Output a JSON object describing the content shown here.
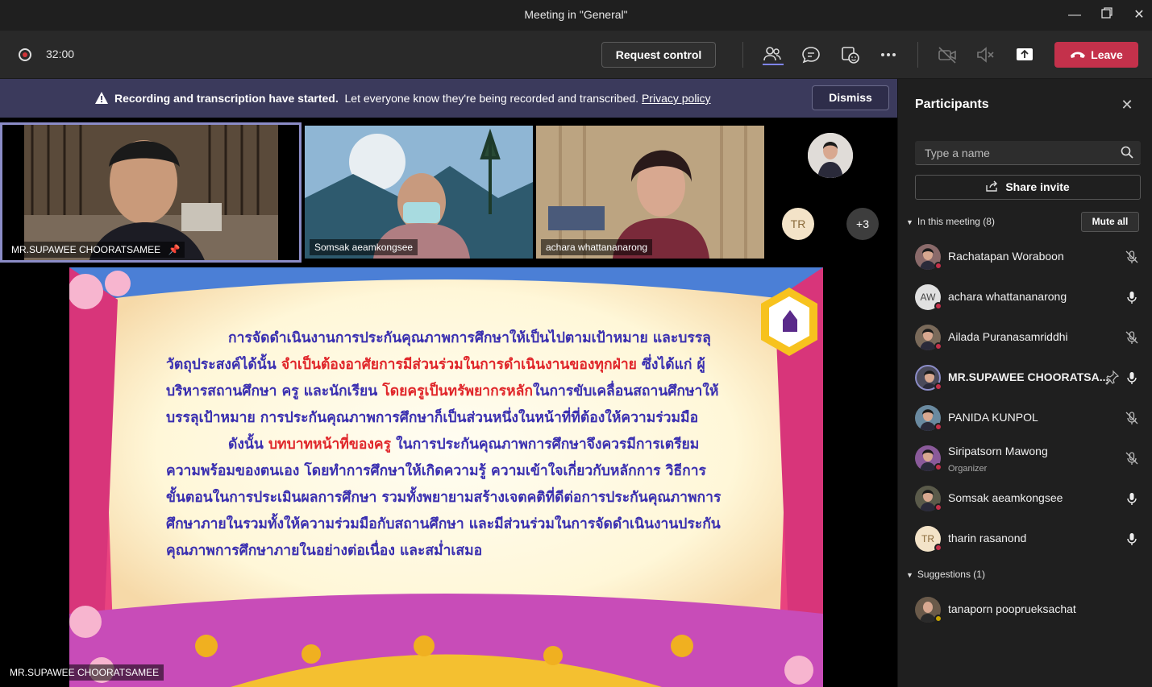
{
  "window": {
    "title": "Meeting in \"General\""
  },
  "toolbar": {
    "timer": "32:00",
    "request_control": "Request control",
    "leave": "Leave"
  },
  "banner": {
    "bold": "Recording and transcription have started.",
    "text": "Let everyone know they're being recorded and transcribed.",
    "link": "Privacy policy",
    "dismiss": "Dismiss"
  },
  "videos": [
    {
      "name": "MR.SUPAWEE CHOORATSAMEE"
    },
    {
      "name": "Somsak aeamkongsee"
    },
    {
      "name": "achara whattananarong"
    }
  ],
  "overflow": {
    "initials": "TR",
    "more": "+3"
  },
  "stage": {
    "presenter": "MR.SUPAWEE CHOORATSAMEE",
    "p1_a": "การจัดดำเนินงานการประกันคุณภาพการศึกษาให้เป็นไปตามเป้าหมาย และบรรลุวัตถุประสงค์ได้นั้น ",
    "p1_red1": "จำเป็นต้องอาศัยการมีส่วนร่วมในการดำเนินงานของทุกฝ่าย",
    "p1_b": " ซึ่งได้แก่ ผู้บริหารสถานศึกษา ครู และนักเรียน ",
    "p1_red2": "โดยครูเป็นทรัพยากรหลัก",
    "p1_c": "ในการขับเคลื่อนสถานศึกษาให้บรรลุเป้าหมาย การประกันคุณภาพการศึกษาก็เป็นส่วนหนึ่งในหน้าที่ที่ต้องให้ความร่วมมือ",
    "p2_a": "ดังนั้น ",
    "p2_red": "บทบาทหน้าที่ของครู",
    "p2_b": " ในการประกันคุณภาพการศึกษาจึงควรมีการเตรียมความพร้อมของตนเอง โดยทำการศึกษาให้เกิดความรู้ ความเข้าใจเกี่ยวกับหลักการ วิธีการ ขั้นตอนในการประเมินผลการศึกษา รวมทั้งพยายามสร้างเจตคติที่ดีต่อการประกันคุณภาพการศึกษาภายในรวมทั้งให้ความร่วมมือกับสถานศึกษา และมีส่วนร่วมในการจัดดำเนินงานประกันคุณภาพการศึกษาภายในอย่างต่อเนื่อง และสม่ำเสมอ"
  },
  "panel": {
    "title": "Participants",
    "search_placeholder": "Type a name",
    "share_invite": "Share invite",
    "in_meeting": "In this meeting (8)",
    "mute_all": "Mute all",
    "suggestions": "Suggestions (1)",
    "participants": [
      {
        "name": "Rachatapan Woraboon",
        "role": "",
        "initials": "",
        "mic": "muted"
      },
      {
        "name": "achara whattananarong",
        "role": "",
        "initials": "AW",
        "mic": "on"
      },
      {
        "name": "Ailada Puranasamriddhi",
        "role": "",
        "initials": "",
        "mic": "muted"
      },
      {
        "name": "MR.SUPAWEE CHOORATSA...",
        "role": "",
        "initials": "",
        "mic": "on"
      },
      {
        "name": "PANIDA KUNPOL",
        "role": "",
        "initials": "",
        "mic": "muted"
      },
      {
        "name": "Siripatsorn Mawong",
        "role": "Organizer",
        "initials": "",
        "mic": "muted"
      },
      {
        "name": "Somsak aeamkongsee",
        "role": "",
        "initials": "",
        "mic": "on"
      },
      {
        "name": "tharin rasanond",
        "role": "",
        "initials": "TR",
        "mic": "on"
      }
    ],
    "suggested": [
      {
        "name": "tanaporn pooprueksachat"
      }
    ]
  },
  "colors": {
    "accent": "#6264a7",
    "leave": "#c4314b",
    "banner": "#3b3a5c"
  }
}
